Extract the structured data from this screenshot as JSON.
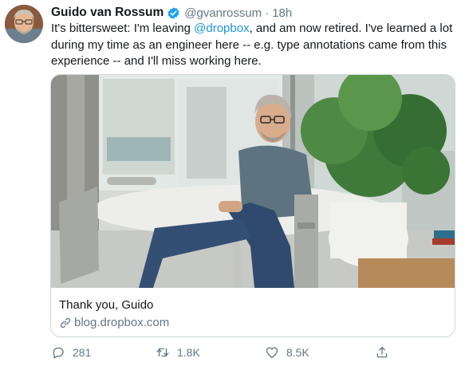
{
  "author": {
    "display_name": "Guido van Rossum",
    "handle": "@gvanrossum",
    "separator": "·",
    "time": "18h",
    "verified": true
  },
  "tweet": {
    "text_before": "It's bittersweet: I'm leaving ",
    "mention": "@dropbox",
    "text_after": ", and am now retired. I've learned a lot during my time as an engineer here -- e.g. type annotations came from this experience -- and I'll miss working here."
  },
  "card": {
    "title": "Thank you, Guido",
    "domain": "blog.dropbox.com",
    "icon": "link-icon"
  },
  "actions": {
    "reply_count": "281",
    "retweet_count": "1.8K",
    "like_count": "8.5K",
    "reply_icon": "reply-icon",
    "retweet_icon": "retweet-icon",
    "like_icon": "heart-icon",
    "share_icon": "share-icon"
  },
  "colors": {
    "link": "#1b95e0",
    "secondary_text": "#657786",
    "border": "#ccd6dd",
    "verified_badge": "#1da1f2"
  }
}
